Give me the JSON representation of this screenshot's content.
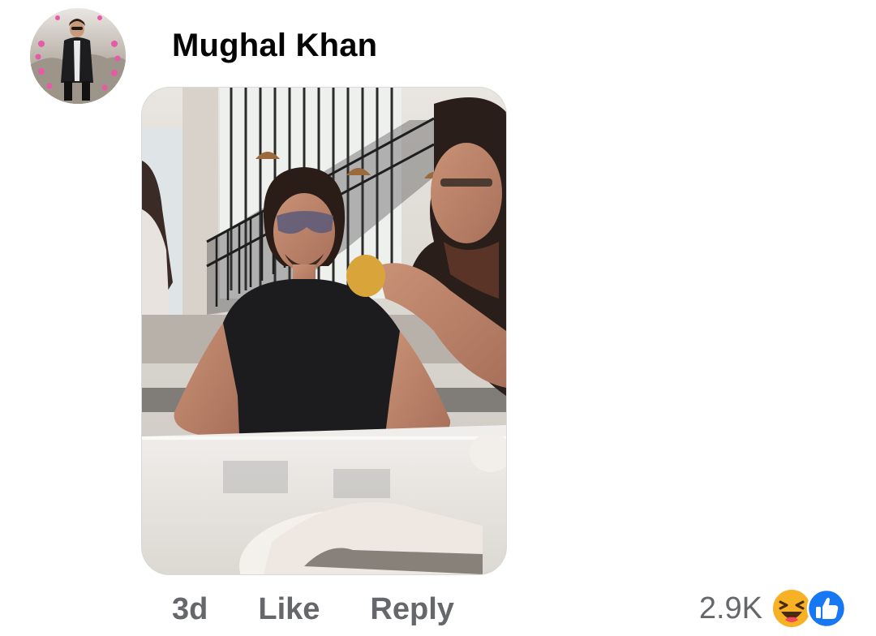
{
  "comment": {
    "author_name": "Mughal Khan",
    "avatar_icon": "profile-photo",
    "attachment_icon": "photo-attachment",
    "timestamp": "3d",
    "like_label": "Like",
    "reply_label": "Reply",
    "reaction_count": "2.9K",
    "reaction_icons": [
      "haha-reaction",
      "like-reaction"
    ]
  },
  "colors": {
    "name_text": "#050505",
    "meta_text": "#65676b",
    "like_blue": "#1877f2",
    "haha_yellow": "#f7b125"
  }
}
